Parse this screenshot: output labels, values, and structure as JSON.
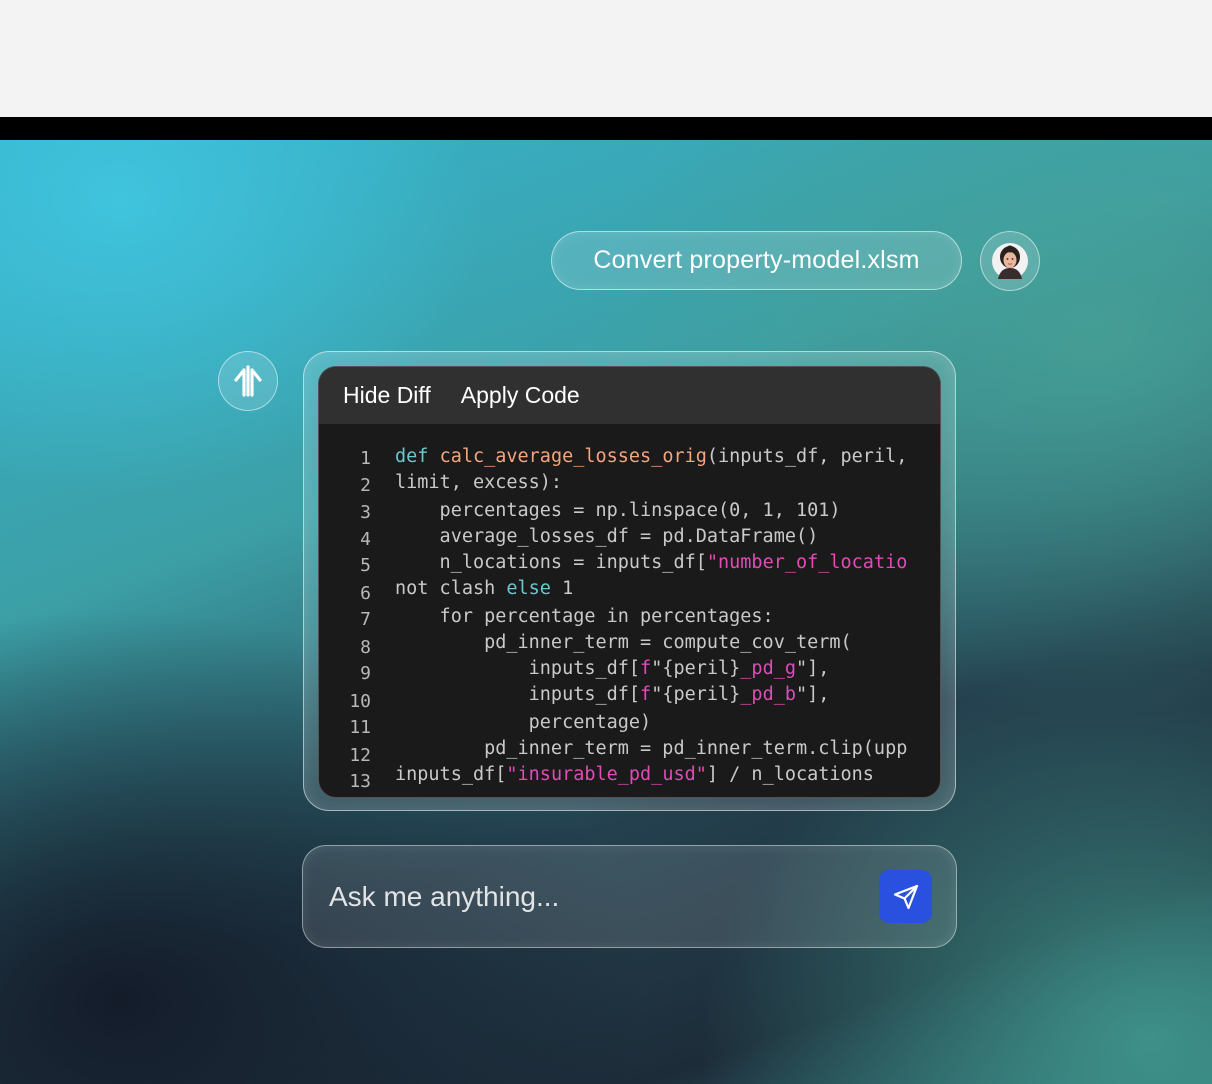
{
  "user_message": {
    "text": "Convert property-model.xlsm"
  },
  "code_panel": {
    "toolbar": {
      "hide_diff": "Hide Diff",
      "apply_code": "Apply Code"
    },
    "lines": [
      {
        "num": "1",
        "tokens": [
          {
            "t": "def",
            "c": "kw"
          },
          {
            "t": " "
          },
          {
            "t": "calc_average_losses_orig",
            "c": "fn"
          },
          {
            "t": "(inputs_df, peril,"
          }
        ]
      },
      {
        "num": "2",
        "tokens": [
          {
            "t": "limit, excess):"
          }
        ]
      },
      {
        "num": "3",
        "tokens": [
          {
            "t": "    percentages = np.linspace(0, 1, 101)"
          }
        ]
      },
      {
        "num": "4",
        "tokens": [
          {
            "t": "    average_losses_df = pd.DataFrame()"
          }
        ]
      },
      {
        "num": "5",
        "tokens": [
          {
            "t": "    n_locations = inputs_df["
          },
          {
            "t": "\"number_of_locatio",
            "c": "str"
          }
        ]
      },
      {
        "num": "6",
        "tokens": [
          {
            "t": "not clash "
          },
          {
            "t": "else",
            "c": "kw"
          },
          {
            "t": " 1"
          }
        ]
      },
      {
        "num": "7",
        "tokens": [
          {
            "t": "    for percentage in percentages:"
          }
        ]
      },
      {
        "num": "8",
        "tokens": [
          {
            "t": "        pd_inner_term = compute_cov_term("
          }
        ]
      },
      {
        "num": "9",
        "tokens": [
          {
            "t": "            inputs_df["
          },
          {
            "t": "f",
            "c": "str"
          },
          {
            "t": "\"{peril}"
          },
          {
            "t": "_pd_g",
            "c": "str"
          },
          {
            "t": "\"],"
          }
        ]
      },
      {
        "num": "10",
        "tokens": [
          {
            "t": "            inputs_df["
          },
          {
            "t": "f",
            "c": "str"
          },
          {
            "t": "\"{peril}"
          },
          {
            "t": "_pd_b",
            "c": "str"
          },
          {
            "t": "\"],"
          }
        ]
      },
      {
        "num": "11",
        "tokens": [
          {
            "t": "            percentage)"
          }
        ]
      },
      {
        "num": "12",
        "tokens": [
          {
            "t": "        pd_inner_term = pd_inner_term.clip(upp"
          }
        ]
      },
      {
        "num": "13",
        "tokens": [
          {
            "t": "inputs_df["
          },
          {
            "t": "\"insurable_pd_usd\"",
            "c": "str"
          },
          {
            "t": "] / n_locations"
          }
        ]
      }
    ]
  },
  "ask_bar": {
    "placeholder": "Ask me anything..."
  },
  "icons": {
    "avatar": "user-avatar-icon",
    "assistant": "assistant-logo-icon",
    "send": "send-icon"
  },
  "colors": {
    "send_button": "#2a50e0",
    "keyword": "#6ec6cf",
    "function": "#f4a57f",
    "string": "#e04bb8",
    "code_bg": "#1a1a1a",
    "toolbar_bg": "#303030"
  }
}
